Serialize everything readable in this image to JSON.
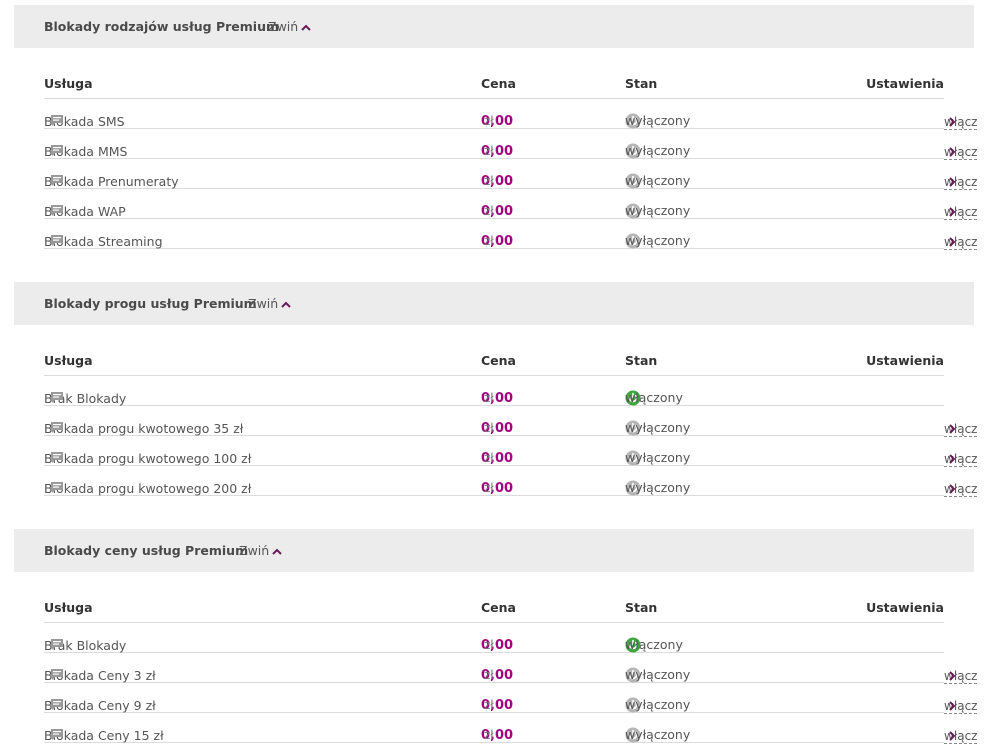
{
  "colors": {
    "accent": "#a1007f",
    "on": "#3fa63f",
    "off": "#b5b5b5",
    "header_bg": "#ececec"
  },
  "icons": {
    "info": "comment-icon",
    "state": "power-icon",
    "collapse": "chevron-up-icon",
    "action": "chevron-right-icon"
  },
  "columns": {
    "service": "Usługa",
    "price": "Cena",
    "state": "Stan",
    "settings": "Ustawienia"
  },
  "sections": [
    {
      "title": "Blokady rodzajów usług Premium",
      "collapse_label": "Zwiń",
      "rows": [
        {
          "name": "Blokada SMS",
          "price": "0,00",
          "currency": "zł",
          "state": "wyłączony",
          "on": false,
          "action": "włącz"
        },
        {
          "name": "Blokada MMS",
          "price": "0,00",
          "currency": "zł",
          "state": "wyłączony",
          "on": false,
          "action": "włącz"
        },
        {
          "name": "Blokada Prenumeraty",
          "price": "0,00",
          "currency": "zł",
          "state": "wyłączony",
          "on": false,
          "action": "włącz"
        },
        {
          "name": "Blokada WAP",
          "price": "0,00",
          "currency": "zł",
          "state": "wyłączony",
          "on": false,
          "action": "włącz"
        },
        {
          "name": "Blokada Streaming",
          "price": "0,00",
          "currency": "zł",
          "state": "wyłączony",
          "on": false,
          "action": "włącz"
        }
      ]
    },
    {
      "title": "Blokady progu usług Premium",
      "collapse_label": "Zwiń",
      "rows": [
        {
          "name": "Brak Blokady",
          "price": "0,00",
          "currency": "zł",
          "state": "włączony",
          "on": true,
          "action": ""
        },
        {
          "name": "Blokada progu kwotowego 35 zł",
          "price": "0,00",
          "currency": "zł",
          "state": "wyłączony",
          "on": false,
          "action": "włącz"
        },
        {
          "name": "Blokada progu kwotowego 100 zł",
          "price": "0,00",
          "currency": "zł",
          "state": "wyłączony",
          "on": false,
          "action": "włącz"
        },
        {
          "name": "Blokada progu kwotowego 200 zł",
          "price": "0,00",
          "currency": "zł",
          "state": "wyłączony",
          "on": false,
          "action": "włącz"
        }
      ]
    },
    {
      "title": "Blokady ceny usług Premium",
      "collapse_label": "Zwiń",
      "rows": [
        {
          "name": "Brak Blokady",
          "price": "0,00",
          "currency": "zł",
          "state": "włączony",
          "on": true,
          "action": ""
        },
        {
          "name": "Blokada Ceny 3 zł",
          "price": "0,00",
          "currency": "zł",
          "state": "wyłączony",
          "on": false,
          "action": "włącz"
        },
        {
          "name": "Blokada Ceny 9 zł",
          "price": "0,00",
          "currency": "zł",
          "state": "wyłączony",
          "on": false,
          "action": "włącz"
        },
        {
          "name": "Blokada Ceny 15 zł",
          "price": "0,00",
          "currency": "zł",
          "state": "wyłączony",
          "on": false,
          "action": "włącz"
        }
      ]
    }
  ]
}
